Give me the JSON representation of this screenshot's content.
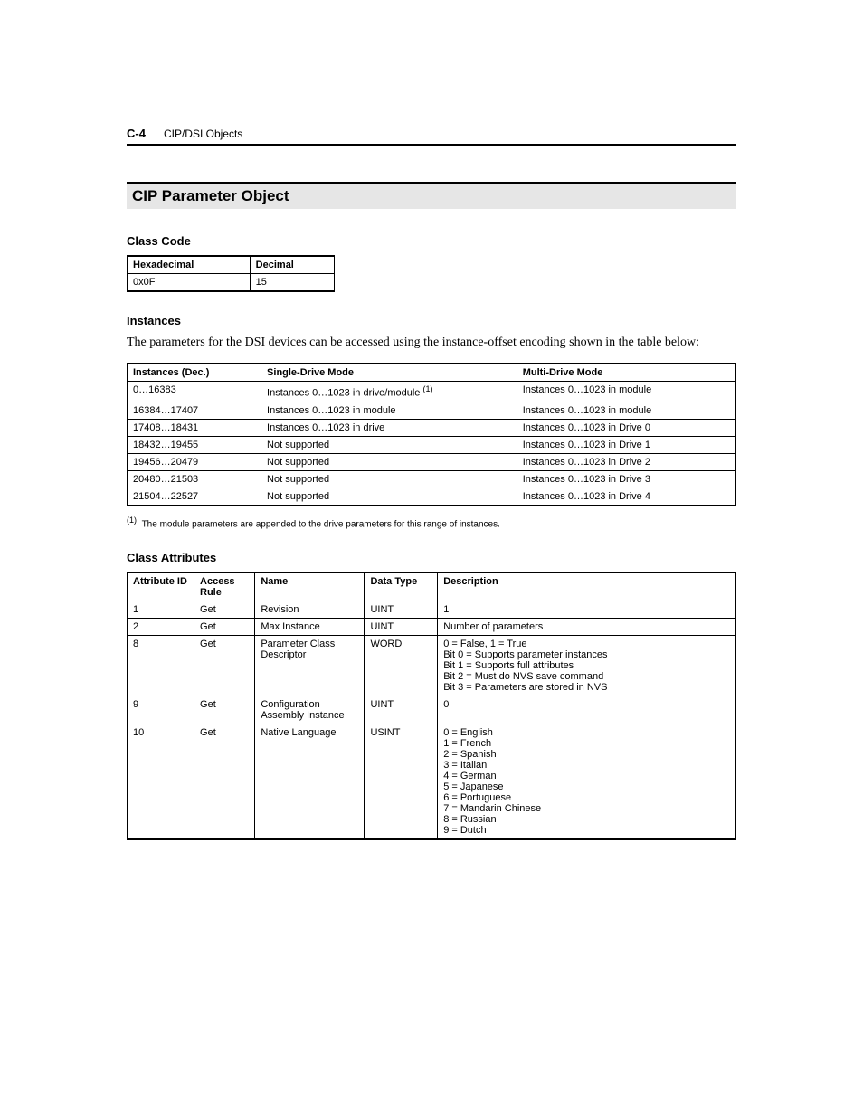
{
  "header": {
    "pagenum": "C-4",
    "chapter": "CIP/DSI Objects"
  },
  "section_title": "CIP Parameter Object",
  "classcode": {
    "title": "Class Code",
    "headers": [
      "Hexadecimal",
      "Decimal"
    ],
    "row": [
      "0x0F",
      "15"
    ]
  },
  "instances": {
    "title": "Instances",
    "body": "The parameters for the DSI devices can be accessed using the instance-offset encoding shown in the table below:",
    "headers": [
      "Instances (Dec.)",
      "Single-Drive Mode",
      "Multi-Drive Mode"
    ],
    "rows": [
      [
        "0…16383",
        "Instances 0…1023 in drive/module ",
        "Instances 0…1023 in module"
      ],
      [
        "16384…17407",
        "Instances 0…1023 in module",
        "Instances 0…1023 in module"
      ],
      [
        "17408…18431",
        "Instances 0…1023 in drive",
        "Instances 0…1023 in Drive 0"
      ],
      [
        "18432…19455",
        "Not supported",
        "Instances 0…1023 in Drive 1"
      ],
      [
        "19456…20479",
        "Not supported",
        "Instances 0…1023 in Drive 2"
      ],
      [
        "20480…21503",
        "Not supported",
        "Instances 0…1023 in Drive 3"
      ],
      [
        "21504…22527",
        "Not supported",
        "Instances 0…1023 in Drive 4"
      ]
    ],
    "footnote_marker": "(1)",
    "footnote_text": "The module parameters are appended to the drive parameters for this range of instances."
  },
  "classattrs": {
    "title": "Class Attributes",
    "headers": [
      "Attribute ID",
      "Access Rule",
      "Name",
      "Data Type",
      "Description"
    ],
    "rows": [
      {
        "id": "1",
        "access": "Get",
        "name": "Revision",
        "dtype": "UINT",
        "desc": "1"
      },
      {
        "id": "2",
        "access": "Get",
        "name": "Max Instance",
        "dtype": "UINT",
        "desc": "Number of parameters"
      },
      {
        "id": "8",
        "access": "Get",
        "name": "Parameter Class Descriptor",
        "dtype": "WORD",
        "desc": "0 = False, 1 = True\nBit 0 = Supports parameter instances\nBit 1 = Supports full attributes\nBit 2 = Must do NVS save command\nBit 3 = Parameters are stored in NVS"
      },
      {
        "id": "9",
        "access": "Get",
        "name": "Configuration Assembly Instance",
        "dtype": "UINT",
        "desc": "0"
      },
      {
        "id": "10",
        "access": "Get",
        "name": "Native Language",
        "dtype": "USINT",
        "desc": "0 = English\n1 = French\n2 = Spanish\n3 = Italian\n4 = German\n5 = Japanese\n6 = Portuguese\n7 = Mandarin Chinese\n8 = Russian\n9 = Dutch"
      }
    ]
  }
}
